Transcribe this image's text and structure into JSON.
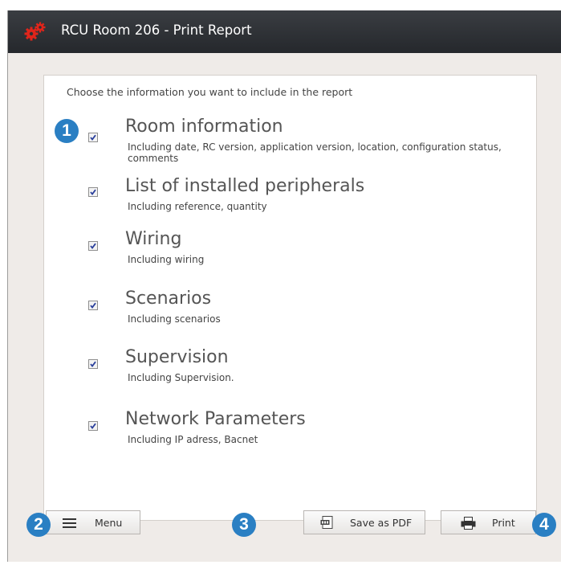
{
  "window": {
    "title": "RCU Room 206 - Print Report",
    "icon": "gears-icon"
  },
  "panel": {
    "instruction": "Choose the information you want to include in the report"
  },
  "options": [
    {
      "title": "Room information",
      "description": "Including date, RC version, application version, location, configuration status, comments",
      "checked": true
    },
    {
      "title": "List of installed peripherals",
      "description": "Including reference, quantity",
      "checked": true
    },
    {
      "title": "Wiring",
      "description": "Including wiring",
      "checked": true
    },
    {
      "title": "Scenarios",
      "description": "Including scenarios",
      "checked": true
    },
    {
      "title": "Supervision",
      "description": "Including Supervision.",
      "checked": true
    },
    {
      "title": "Network Parameters",
      "description": "Including IP adress, Bacnet",
      "checked": true
    }
  ],
  "buttons": {
    "menu": {
      "label": "Menu",
      "icon": "hamburger-icon"
    },
    "save_pdf": {
      "label": "Save as PDF",
      "icon": "pdf-icon"
    },
    "print": {
      "label": "Print",
      "icon": "printer-icon"
    }
  },
  "callouts": [
    "1",
    "2",
    "3",
    "4"
  ],
  "colors": {
    "titlebar": "#2d3035",
    "callout": "#2a7fc3",
    "gear": "#e0251b"
  }
}
